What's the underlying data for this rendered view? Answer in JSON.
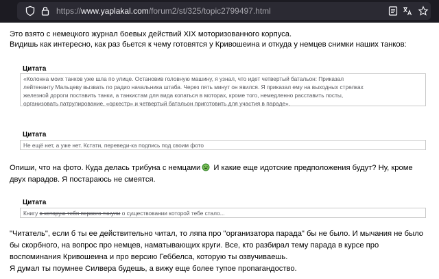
{
  "browser": {
    "url_protocol": "https://",
    "url_host": "www.yaplakal.com",
    "url_path": "/forum2/st/325/topic2799497.html",
    "icons": [
      "shield-icon",
      "lock-icon",
      "reader-view-icon",
      "translate-icon",
      "bookmark-star-icon"
    ],
    "colors": {
      "toolbar": "#1c1b22",
      "urlbar": "#2b2a33",
      "host_text": "#fbfbfe",
      "dim_text": "#a7a6ad"
    }
  },
  "post": {
    "intro_line1": "Это взято с немецкого журнал боевых действий XIX моторизованного корпуса.",
    "intro_line2": "Видишь как интересно, как раз бьется к чему готовятся у Кривошеина и откуда у немцев снимки наших танков:",
    "quote1": {
      "title": "Цитата",
      "line1": "«Колонна моих танков уже шла по улице. Остановив головную машину, я узнал, что идет четвертый батальон: Приказал",
      "line2": "лейтенанту Мальцеву вызвать по радио начальника штаба. Через пять минут он явился. Я приказал ему на выходных стрелках",
      "line3": "железной дороги поставить танки, а танкистам для вида копаться в моторах, кроме того, немедленно расставить посты,",
      "line4": "организовать патрулирование, «оркестр» и четвертый батальон приготовить для участия в параде»."
    },
    "quote2": {
      "title": "Цитата",
      "text": "Не ещё нет, а уже нет. Кстати, переведи-ка подпись под своим фото"
    },
    "reply_line1_a": "Опиши, что на фото. Куда делась трибуна с немцами",
    "reply_line1_b": " И какие еще идотские предположения будут? Ну, кроме",
    "reply_line2": "двух парадов. Я постараюсь не смеятся.",
    "smiley_icon": "laughing-smiley-icon",
    "quote3": {
      "title": "Цитата",
      "text_plain_start": "Книгу ",
      "text_struck": "в которую тебя первого ткнули",
      "text_plain_end": " о существовании которой тебе стало..."
    },
    "final_line1": "\"Читатель\", если б ты ее действительно читал, то ляпа про \"организатора парада\" бы не было. И мычания не было",
    "final_line2": "бы скорбного, на вопрос про немцев, наматывающих круги. Все, кто разбирал тему парада в курсе про",
    "final_line3": "воспоминания Кривошеина и про версию Геббелса, которую ты озвучиваешь.",
    "final_line4": "Я думал ты поумнее Силвера будешь, а вижу еще более тупое пропагандоство."
  }
}
